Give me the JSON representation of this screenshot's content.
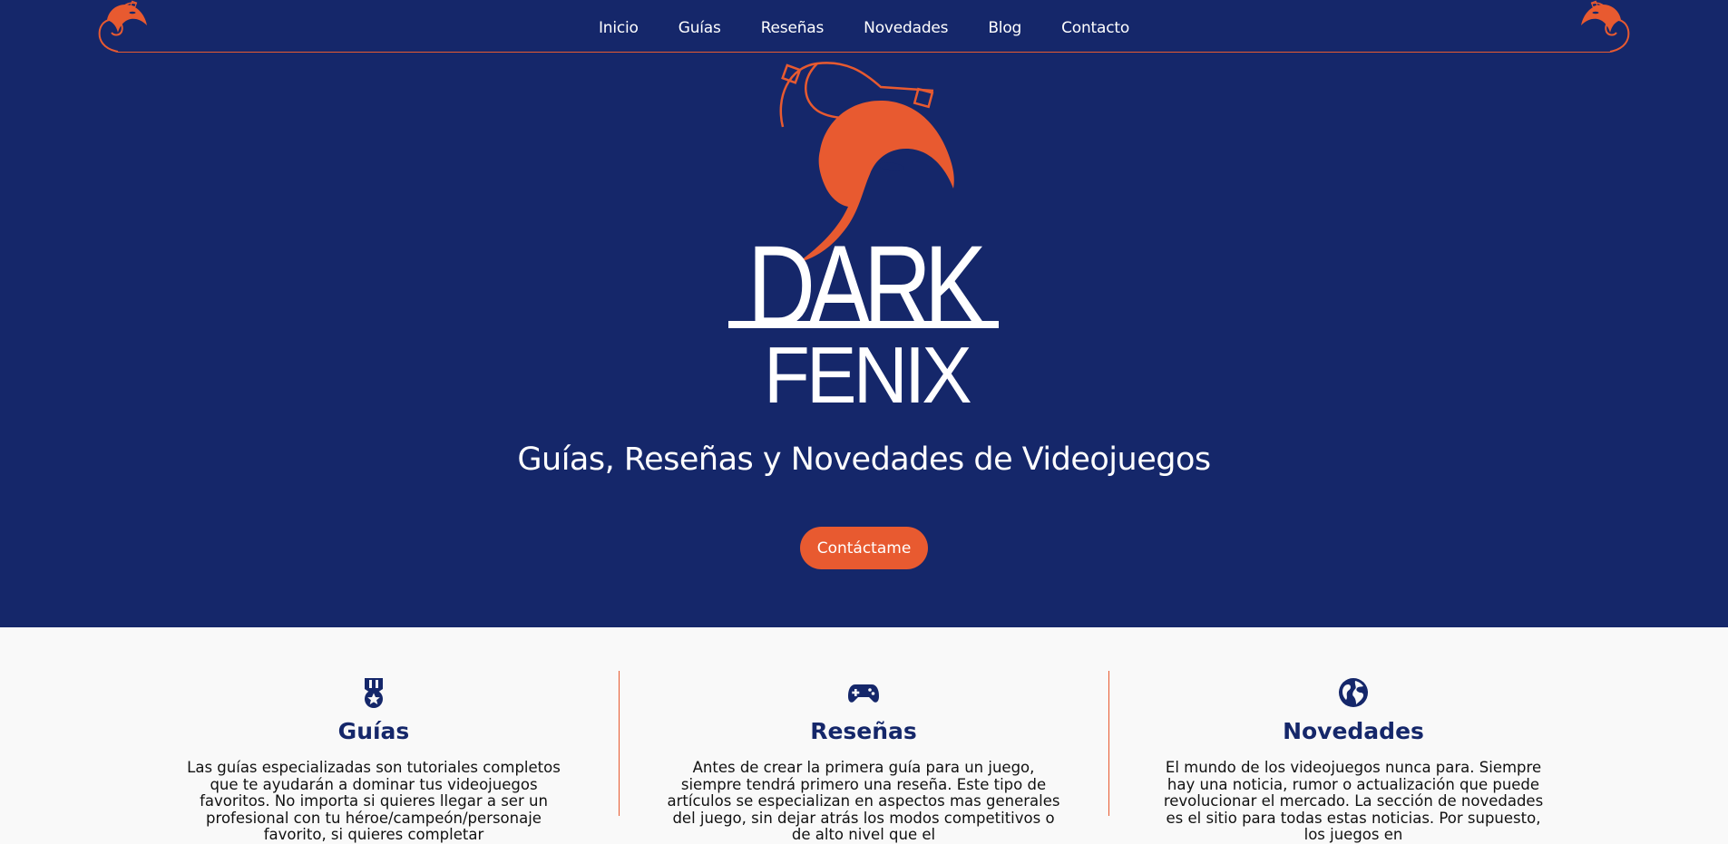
{
  "nav": {
    "items": [
      {
        "label": "Inicio"
      },
      {
        "label": "Guías"
      },
      {
        "label": "Reseñas"
      },
      {
        "label": "Novedades"
      },
      {
        "label": "Blog"
      },
      {
        "label": "Contacto"
      }
    ]
  },
  "hero": {
    "logo_text_top": "DARK",
    "logo_text_bottom": "FENIX",
    "tagline": "Guías, Reseñas y Novedades de Videojuegos",
    "cta_label": "Contáctame"
  },
  "features": [
    {
      "icon": "medal-icon",
      "title": "Guías",
      "text": "Las guías especializadas son tutoriales completos que te ayudarán a dominar tus videojuegos favoritos. No importa si quieres llegar a ser un profesional con tu héroe/campeón/personaje favorito, si quieres completar"
    },
    {
      "icon": "gamepad-icon",
      "title": "Reseñas",
      "text": "Antes de crear la primera guía para un juego, siempre tendrá primero una reseña. Este tipo de artículos se especializan en aspectos mas generales del juego, sin dejar atrás los modos competitivos o de alto nivel que el"
    },
    {
      "icon": "globe-icon",
      "title": "Novedades",
      "text": "El mundo de los videojuegos nunca para. Siempre hay una noticia, rumor o actualización que puede revolucionar el mercado. La sección de novedades es el sitio para todas estas noticias. Por supuesto, los juegos en"
    }
  ],
  "colors": {
    "primary": "#15276a",
    "accent": "#e85a30",
    "background": "#f9f9f9",
    "text_light": "#ffffff"
  }
}
